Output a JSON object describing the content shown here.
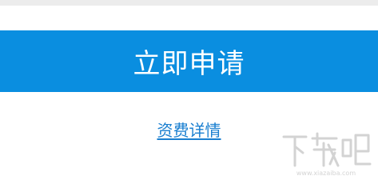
{
  "apply_button": {
    "label": "立即申请"
  },
  "fee_link": {
    "label": "资费详情"
  },
  "watermark": {
    "logo_text": "下载吧",
    "url_text": "www.xiazaiba.com"
  },
  "colors": {
    "accent": "#0a8ee0",
    "link": "#1a7fd0",
    "top_strip": "#ececec",
    "background": "#ffffff"
  }
}
